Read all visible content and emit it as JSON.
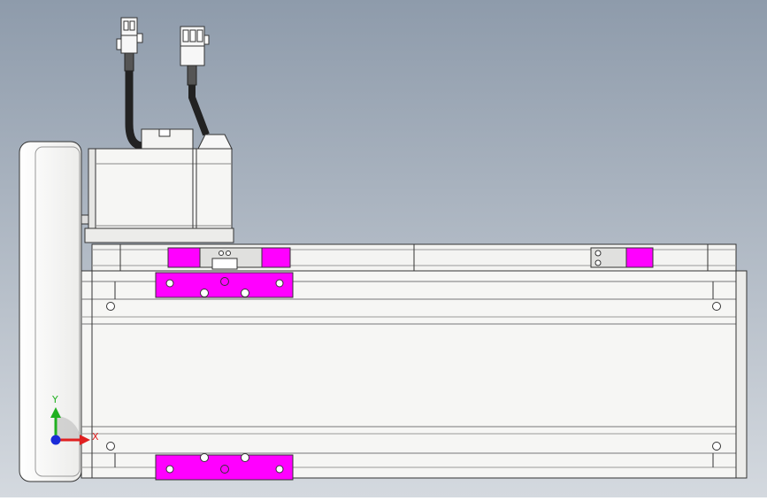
{
  "viewport": {
    "background_top": "#8e9bab",
    "background_bottom": "#d4d9df"
  },
  "triad": {
    "x_label": "X",
    "y_label": "Y",
    "x_color": "#e02020",
    "y_color": "#20b020",
    "origin_color": "#1a2bd8"
  },
  "model": {
    "body_color": "#f4f4f2",
    "edge_color": "#333333",
    "highlight_color": "#ff00ff",
    "bracket_color": "#e8e8e8",
    "cable_color": "#2a2a2a",
    "connector_color": "#f7f7f7"
  }
}
